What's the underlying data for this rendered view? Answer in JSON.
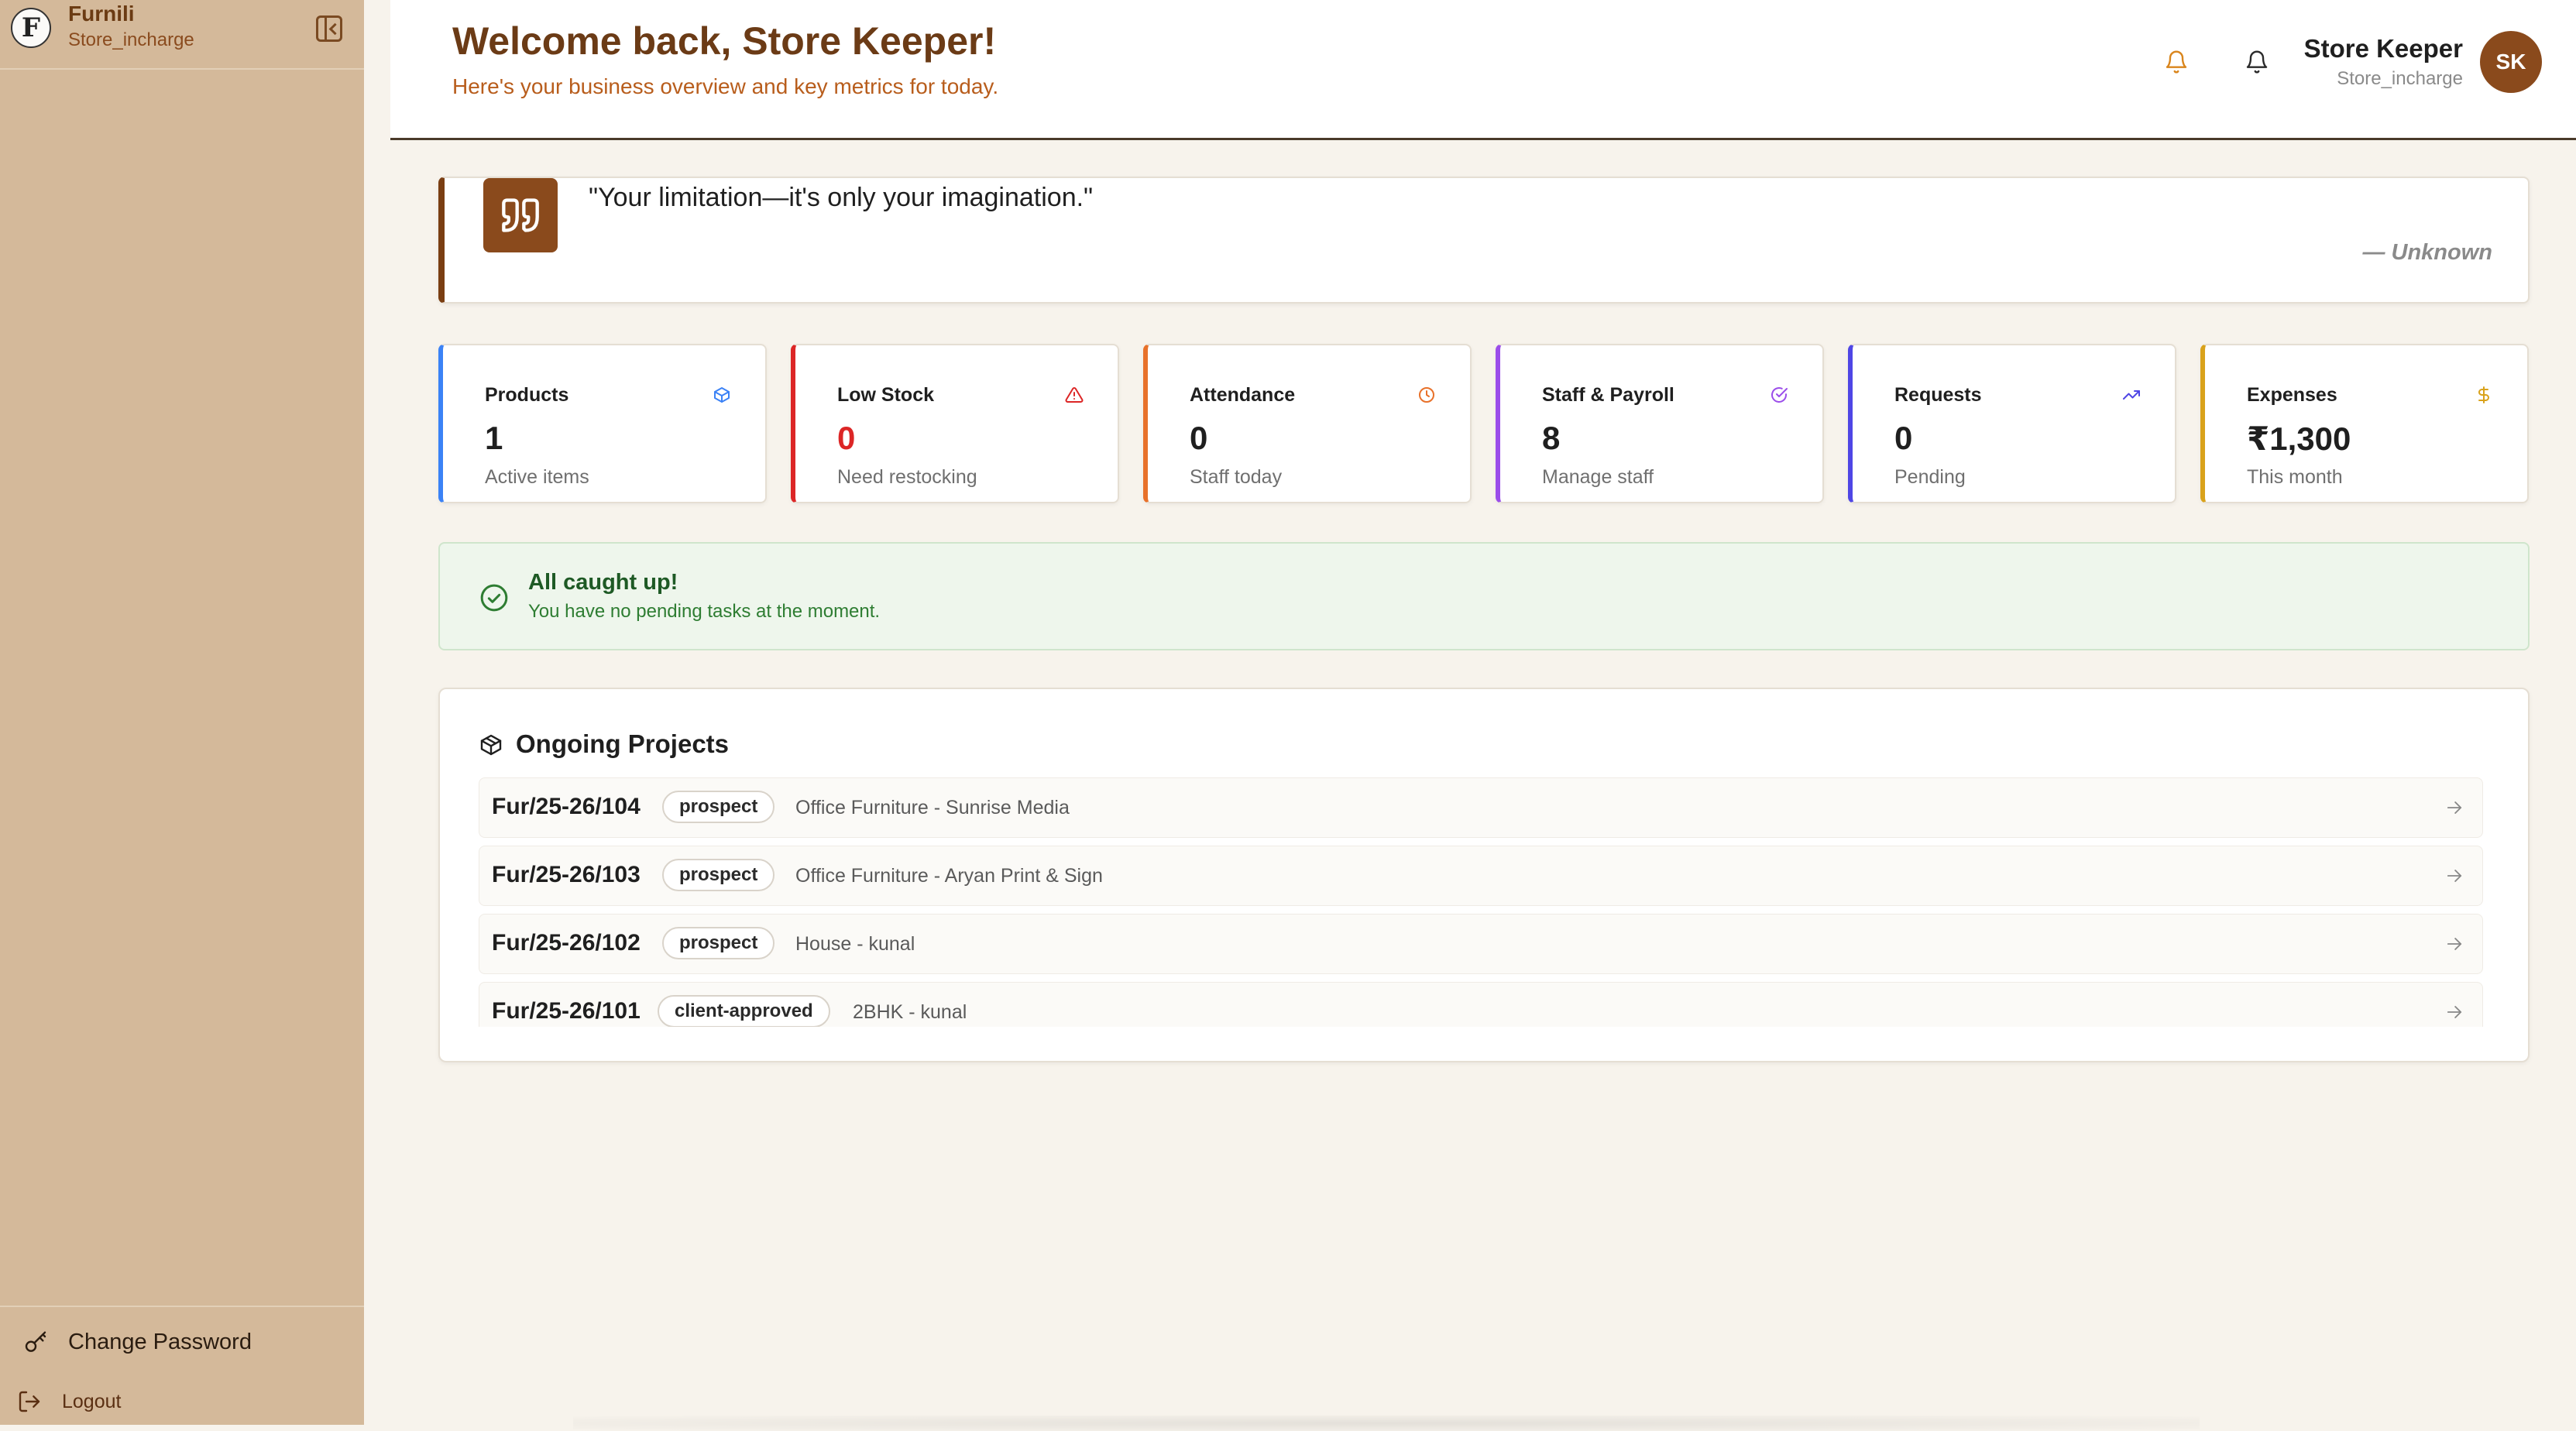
{
  "sidebar": {
    "app_name": "Furnili",
    "role": "Store_incharge",
    "logo_letter": "F",
    "footer": {
      "change_password": "Change Password",
      "logout": "Logout"
    }
  },
  "header": {
    "title": "Welcome back, Store Keeper!",
    "subtitle": "Here's your business overview and key metrics for today.",
    "user_name": "Store Keeper",
    "user_role": "Store_incharge",
    "avatar_initials": "SK"
  },
  "quote": {
    "text": "\"Your limitation—it's only your imagination.\"",
    "author": "— Unknown"
  },
  "stats": [
    {
      "label": "Products",
      "value": "1",
      "sub": "Active items",
      "color": "#3b82f6",
      "icon": "cube-icon"
    },
    {
      "label": "Low Stock",
      "value": "0",
      "sub": "Need restocking",
      "color": "#dc2626",
      "icon": "warning-triangle-icon"
    },
    {
      "label": "Attendance",
      "value": "0",
      "sub": "Staff today",
      "color": "#e8712a",
      "icon": "clock-icon"
    },
    {
      "label": "Staff & Payroll",
      "value": "8",
      "sub": "Manage staff",
      "color": "#9b4dea",
      "icon": "check-circle-icon"
    },
    {
      "label": "Requests",
      "value": "0",
      "sub": "Pending",
      "color": "#4f46e5",
      "icon": "trending-up-icon"
    },
    {
      "label": "Expenses",
      "value": "₹1,300",
      "sub": "This month",
      "color": "#d9a21b",
      "icon": "dollar-icon"
    }
  ],
  "notice": {
    "title": "All caught up!",
    "subtitle": "You have no pending tasks at the moment."
  },
  "projects": {
    "title": "Ongoing Projects",
    "items": [
      {
        "code": "Fur/25-26/104",
        "status": "prospect",
        "description": "Office Furniture - Sunrise Media"
      },
      {
        "code": "Fur/25-26/103",
        "status": "prospect",
        "description": "Office Furniture - Aryan Print & Sign"
      },
      {
        "code": "Fur/25-26/102",
        "status": "prospect",
        "description": "House - kunal"
      },
      {
        "code": "Fur/25-26/101",
        "status": "client-approved",
        "description": "2BHK - kunal"
      }
    ]
  },
  "colors": {
    "brand": "#8a4a1c",
    "sidebar_bg": "#d4b99a",
    "page_bg": "#f7f3ec",
    "success_bg": "#eef6ec"
  }
}
